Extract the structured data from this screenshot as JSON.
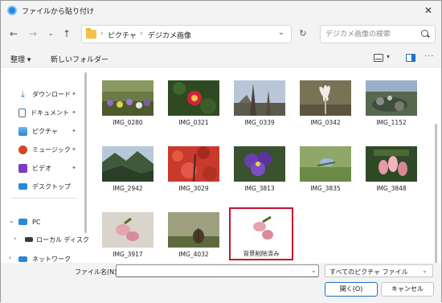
{
  "window": {
    "title": "ファイルから貼り付け",
    "close_glyph": "✕"
  },
  "nav": {
    "back": "←",
    "forward": "→",
    "recent": "⌄",
    "up": "↑",
    "breadcrumb": [
      "ピクチャ",
      "デジカメ画像"
    ],
    "separator": "›",
    "refresh": "↻",
    "search_placeholder": "デジカメ画像の検索"
  },
  "toolbar": {
    "organize_label": "整理 ▾",
    "new_folder_label": "新しいフォルダー",
    "more": "···"
  },
  "sidebar": {
    "items": [
      {
        "label": "ダウンロード",
        "icon": "download-icon",
        "color": "#2b88d8",
        "pinned": true
      },
      {
        "label": "ドキュメント",
        "icon": "document-icon",
        "color": "#5b6b7a",
        "pinned": true
      },
      {
        "label": "ピクチャ",
        "icon": "pictures-icon",
        "color": "#2b88d8",
        "pinned": true
      },
      {
        "label": "ミュージック",
        "icon": "music-icon",
        "color": "#d24726",
        "pinned": true
      },
      {
        "label": "ビデオ",
        "icon": "video-icon",
        "color": "#7a3fbf",
        "pinned": true
      },
      {
        "label": "デスクトップ",
        "icon": "desktop-icon",
        "color": "#2b88d8",
        "pinned": false
      },
      {
        "label": "PC",
        "icon": "pc-icon",
        "color": "#2b88d8",
        "pinned": false
      },
      {
        "label": "ローカル ディスク",
        "icon": "disk-icon",
        "color": "#3a3a3a",
        "pinned": false
      },
      {
        "label": "ネットワーク",
        "icon": "network-icon",
        "color": "#2b88d8",
        "pinned": false
      }
    ],
    "pin_glyph": "📌",
    "expand_glyph": "›",
    "collapse_glyph": "⌄"
  },
  "files": [
    {
      "name": "IMG_0280"
    },
    {
      "name": "IMG_0321"
    },
    {
      "name": "IMG_0339"
    },
    {
      "name": "IMG_0342"
    },
    {
      "name": "IMG_1152"
    },
    {
      "name": "IMG_2942"
    },
    {
      "name": "IMG_3029"
    },
    {
      "name": "IMG_3813"
    },
    {
      "name": "IMG_3835"
    },
    {
      "name": "IMG_3848"
    },
    {
      "name": "IMG_3917"
    },
    {
      "name": "IMG_4032"
    },
    {
      "name": "背景削除済み",
      "selected": true
    }
  ],
  "footer": {
    "filename_label": "ファイル名(N):",
    "filename_value": "",
    "filetype_value": "すべてのピクチャ ファイル",
    "open_label": "開く(O)",
    "cancel_label": "キャンセル"
  },
  "colors": {
    "accent": "#1f6fc7",
    "selection_outline": "#c8102e",
    "folder": "#f6c244"
  }
}
